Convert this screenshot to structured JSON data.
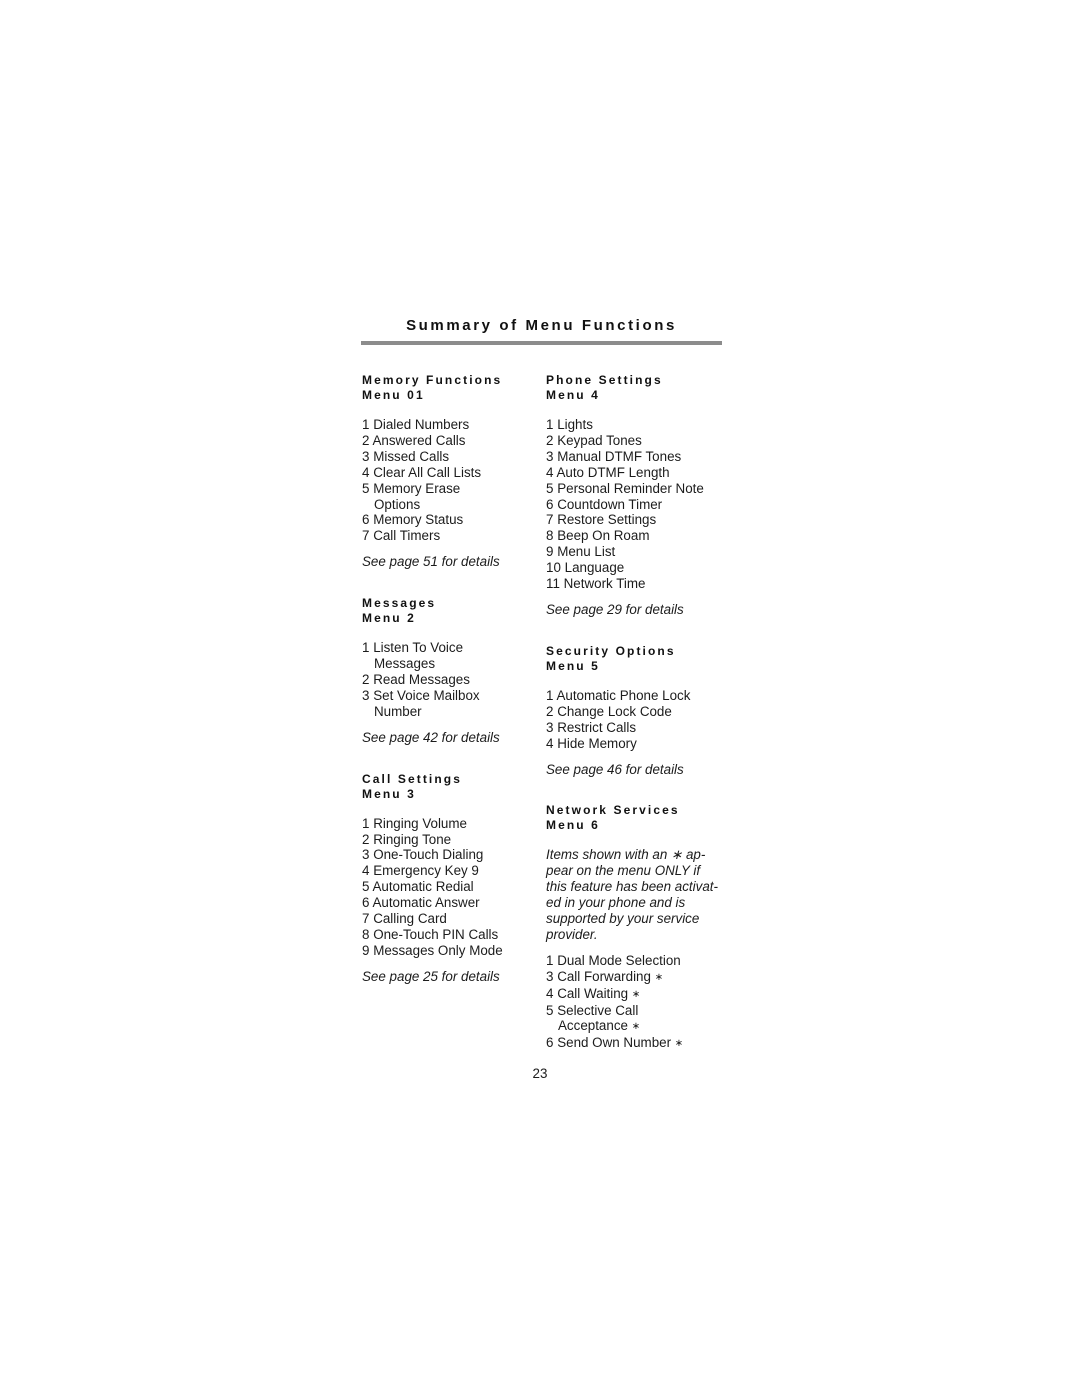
{
  "page": {
    "title": "Summary of Menu Functions",
    "page_number": "23"
  },
  "left_column": [
    {
      "heading": "Memory Functions",
      "menu": "Menu 01",
      "items": [
        {
          "num": "1",
          "label": "Dialed Numbers"
        },
        {
          "num": "2",
          "label": "Answered Calls"
        },
        {
          "num": "3",
          "label": "Missed Calls"
        },
        {
          "num": "4",
          "label": "Clear All Call Lists"
        },
        {
          "num": "5",
          "label": "Memory Erase",
          "cont": "Options"
        },
        {
          "num": "6",
          "label": "Memory Status"
        },
        {
          "num": "7",
          "label": "Call Timers"
        }
      ],
      "note": "See page 51 for details"
    },
    {
      "heading": "Messages",
      "menu": "Menu 2",
      "items": [
        {
          "num": "1",
          "label": "Listen To Voice",
          "cont": "Messages"
        },
        {
          "num": "2",
          "label": "Read Messages"
        },
        {
          "num": "3",
          "label": "Set Voice Mailbox",
          "cont": "Number"
        }
      ],
      "note": "See page 42 for details"
    },
    {
      "heading": "Call Settings",
      "menu": "Menu 3",
      "items": [
        {
          "num": "1",
          "label": "Ringing Volume"
        },
        {
          "num": "2",
          "label": "Ringing Tone"
        },
        {
          "num": "3",
          "label": "One-Touch Dialing"
        },
        {
          "num": "4",
          "label": "Emergency Key 9"
        },
        {
          "num": "5",
          "label": "Automatic Redial"
        },
        {
          "num": "6",
          "label": "Automatic Answer"
        },
        {
          "num": "7",
          "label": "Calling Card"
        },
        {
          "num": "8",
          "label": "One-Touch PIN Calls"
        },
        {
          "num": "9",
          "label": "Messages Only Mode"
        }
      ],
      "note": "See page 25 for details"
    }
  ],
  "right_column": [
    {
      "heading": "Phone Settings",
      "menu": "Menu 4",
      "items": [
        {
          "num": "1",
          "label": "Lights"
        },
        {
          "num": "2",
          "label": "Keypad Tones"
        },
        {
          "num": "3",
          "label": "Manual DTMF Tones"
        },
        {
          "num": "4",
          "label": "Auto DTMF Length"
        },
        {
          "num": "5",
          "label": "Personal Reminder Note"
        },
        {
          "num": "6",
          "label": "Countdown Timer"
        },
        {
          "num": "7",
          "label": "Restore Settings"
        },
        {
          "num": "8",
          "label": "Beep On Roam"
        },
        {
          "num": "9",
          "label": "Menu List"
        },
        {
          "num": "10",
          "label": "Language"
        },
        {
          "num": "11",
          "label": "Network Time"
        }
      ],
      "note": "See page 29 for details"
    },
    {
      "heading": "Security Options",
      "menu": "Menu 5",
      "items": [
        {
          "num": "1",
          "label": "Automatic Phone Lock"
        },
        {
          "num": "2",
          "label": "Change Lock Code"
        },
        {
          "num": "3",
          "label": "Restrict Calls"
        },
        {
          "num": "4",
          "label": "Hide Memory"
        }
      ],
      "note": "See page 46 for details"
    },
    {
      "heading": "Network Services",
      "menu": "Menu 6",
      "description_lines": [
        "Items shown with an ∗ ap-",
        "pear on the menu ONLY if",
        "this feature has been activat-",
        "ed in your phone and is",
        "supported by your service",
        "provider."
      ],
      "items": [
        {
          "num": "1",
          "label": "Dual Mode Selection"
        },
        {
          "num": "3",
          "label": "Call Forwarding",
          "star": "∗"
        },
        {
          "num": "4",
          "label": "Call Waiting",
          "star": "∗"
        },
        {
          "num": "5",
          "label": "Selective Call",
          "cont": "Acceptance",
          "star": "∗"
        },
        {
          "num": "6",
          "label": "Send Own Number",
          "star": "∗"
        }
      ]
    }
  ]
}
